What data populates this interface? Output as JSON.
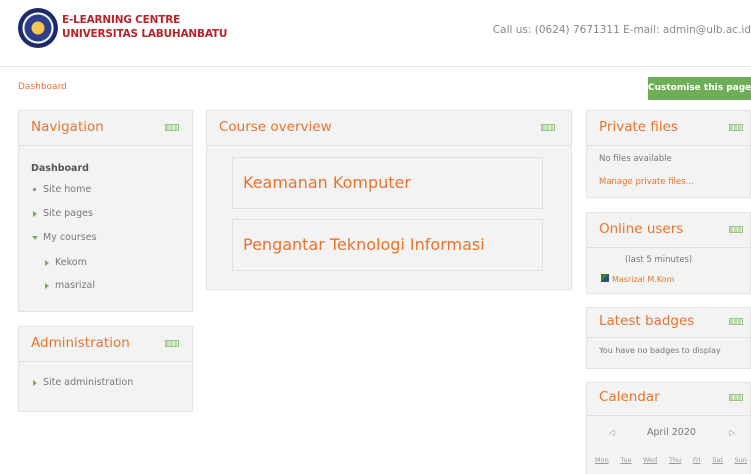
{
  "header": {
    "brand_line1": "E-LEARNING CENTRE",
    "brand_line2": "UNIVERSITAS LABUHANBATU",
    "contact": "Call us: (0624) 7671311   E-mail: admin@ulb.ac.id"
  },
  "breadcrumb": "Dashboard",
  "customise_button": "Customise this page",
  "navigation": {
    "title": "Navigation",
    "items": [
      {
        "label": "Dashboard"
      },
      {
        "label": "Site home"
      },
      {
        "label": "Site pages"
      },
      {
        "label": "My courses"
      },
      {
        "label": "Kekom"
      },
      {
        "label": "masrizal"
      }
    ]
  },
  "administration": {
    "title": "Administration",
    "items": [
      {
        "label": "Site administration"
      }
    ]
  },
  "course_overview": {
    "title": "Course overview",
    "courses": [
      {
        "name": "Keamanan Komputer"
      },
      {
        "name": "Pengantar Teknologi Informasi"
      }
    ]
  },
  "private_files": {
    "title": "Private files",
    "empty_text": "No files available",
    "manage_link": "Manage private files..."
  },
  "online_users": {
    "title": "Online users",
    "period": "(last 5 minutes)",
    "users": [
      {
        "name": "Masrizal M.Kom"
      }
    ]
  },
  "latest_badges": {
    "title": "Latest badges",
    "empty_text": "You have no badges to display"
  },
  "calendar": {
    "title": "Calendar",
    "month": "April 2020",
    "prev": "◁",
    "next": "▷",
    "weekdays": [
      "Mon",
      "Tue",
      "Wed",
      "Thu",
      "Fri",
      "Sat",
      "Sun"
    ]
  },
  "colors": {
    "accent_orange": "#e8732c",
    "button_green": "#6fae58",
    "brand_red": "#b3262b"
  }
}
